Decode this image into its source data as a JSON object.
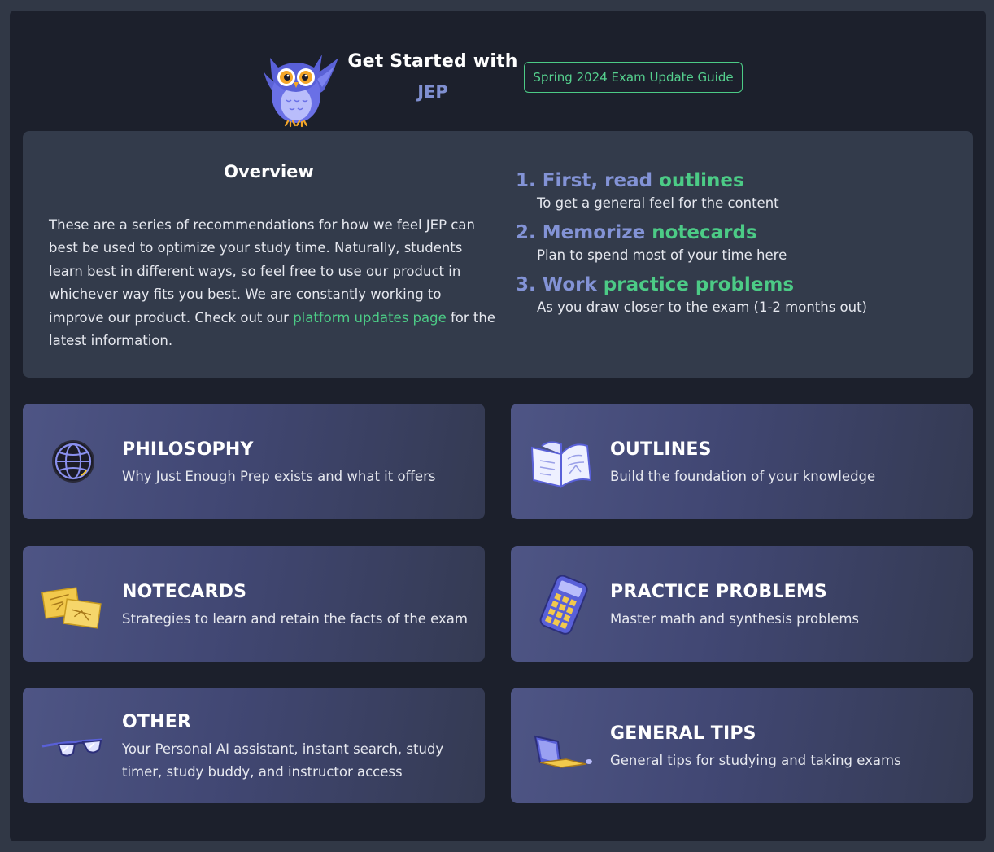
{
  "header": {
    "title": "Get Started with",
    "subtitle": "JEP",
    "guide_button": "Spring 2024 Exam Update Guide"
  },
  "overview": {
    "title": "Overview",
    "text_before_link": "These are a series of recommendations for how we feel JEP can best be used to optimize your study time. Naturally, students learn best in different ways, so feel free to use our product in whichever way fits you best. We are constantly working to improve our product. Check out our ",
    "link_text": "platform updates page",
    "text_after_link": " for the latest information.",
    "steps": [
      {
        "number": "1.",
        "verb": "First, read",
        "keyword": "outlines",
        "description": "To get a general feel for the content"
      },
      {
        "number": "2.",
        "verb": "Memorize",
        "keyword": "notecards",
        "description": "Plan to spend most of your time here"
      },
      {
        "number": "3.",
        "verb": "Work",
        "keyword": "practice problems",
        "description": "As you draw closer to the exam (1-2 months out)"
      }
    ]
  },
  "cards": [
    {
      "title": "PHILOSOPHY",
      "description": "Why Just Enough Prep exists and what it offers",
      "icon": "globe-icon"
    },
    {
      "title": "OUTLINES",
      "description": "Build the foundation of your knowledge",
      "icon": "open-book-icon"
    },
    {
      "title": "NOTECARDS",
      "description": "Strategies to learn and retain the facts of the exam",
      "icon": "notecards-icon"
    },
    {
      "title": "PRACTICE PROBLEMS",
      "description": "Master math and synthesis problems",
      "icon": "calculator-icon"
    },
    {
      "title": "OTHER",
      "description": "Your Personal AI assistant, instant search, study timer, study buddy, and instructor access",
      "icon": "glasses-icon"
    },
    {
      "title": "GENERAL TIPS",
      "description": "General tips for studying and taking exams",
      "icon": "laptop-icon"
    }
  ],
  "colors": {
    "accent_green": "#4ccb86",
    "accent_purple": "#8393d6",
    "panel_bg": "#1c202c",
    "overview_bg": "#333b4b"
  }
}
